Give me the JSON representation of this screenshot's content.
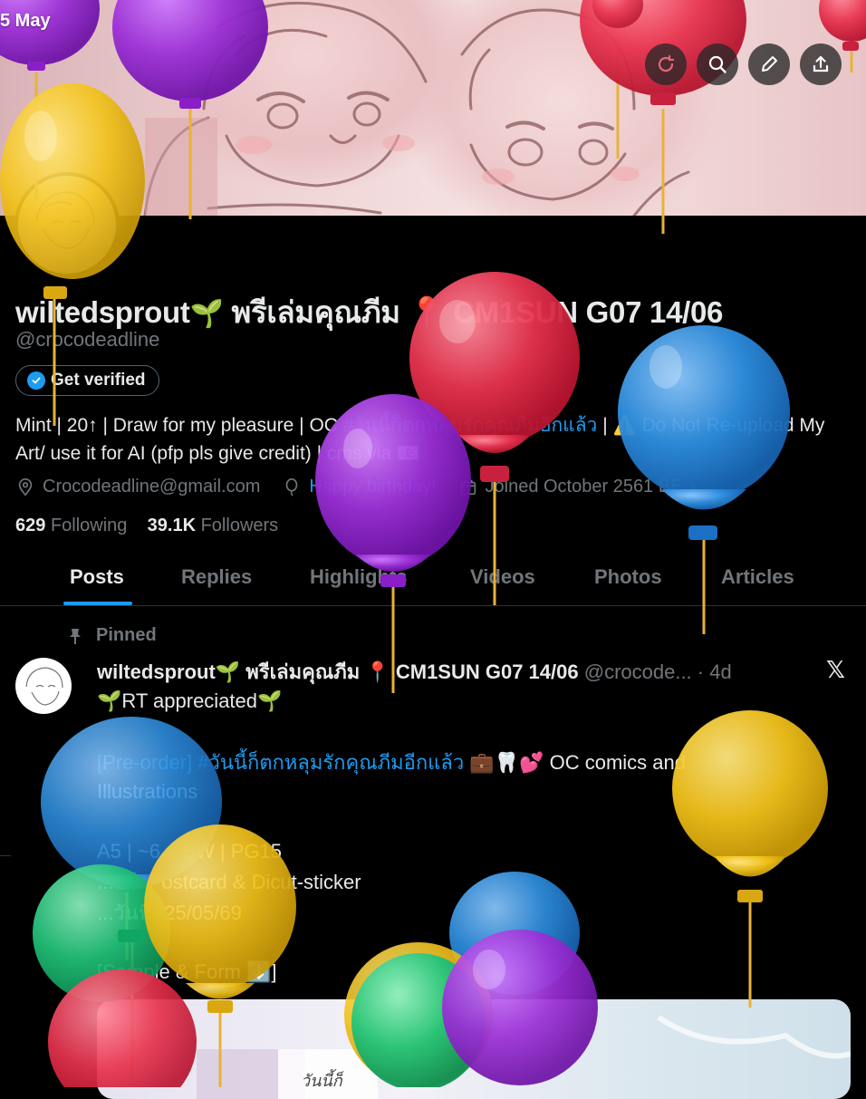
{
  "status_bar": {
    "time": "5 May"
  },
  "header_actions": [
    "refresh-icon",
    "search-icon",
    "edit-icon",
    "share-icon"
  ],
  "profile": {
    "display_name": "wiltedsprout🌱 พรีเล่มคุณภีม 📍 CM1SUN G07 14/06",
    "name_main": "wiltedsprout",
    "name_seed": "🌱",
    "name_rest": " พรีเล่มคุณภีม 📍 CM1SUN G07 14/06",
    "handle": "@crocodeadline",
    "verify_label": "Get verified",
    "bio": {
      "part1": "Mint | 20↑ | Draw for my pleasure | OC ",
      "hashtag": "#วันนี้ก็ตกหลุมรักคุณภีมอีกแล้ว",
      "part2": " | ⚠️ Do Not Re-upload My Art/ use it for AI (pfp pls give credit) | cms via 📧"
    },
    "email": "Crocodeadline@gmail.com",
    "birthday_link": "Happy birthday!",
    "joined": "Joined October 2561 BE",
    "following_count": "629",
    "following_label": "Following",
    "followers_count": "39.1K",
    "followers_label": "Followers"
  },
  "tabs": [
    "Posts",
    "Replies",
    "Highlights",
    "Videos",
    "Photos",
    "Articles"
  ],
  "active_tab": "Posts",
  "post": {
    "pinned_label": "Pinned",
    "author_name": "wiltedsprout🌱 พรีเล่มคุณภีม 📍 CM1SUN G07 14/06",
    "author_handle": "@crocode...",
    "time": "· 4d",
    "line1": "🌱RT appreciated🌱",
    "line2_link1": "[Pre-order]",
    "line2_link2": "#วันนี้ก็ตกหลุมรักคุณภีมอีกแล้ว",
    "line2_rest": " 💼🦷💕 OC comics and",
    "line3": "Illustrations",
    "line4": "A5 | ~6... BW | PG15",
    "line5": "...พรี: Postcard & Dicut-sticker",
    "line6": "...วันนี้- 25/05/69",
    "line7": "[Sample & Form ⬇️]",
    "media_title": "วันนี้ก็"
  },
  "colors": {
    "accent": "#1d9bf0",
    "background": "#000000",
    "text": "#e7e9ea",
    "muted": "#71767b",
    "balloon_red": "#e8334f",
    "balloon_purple": "#9b2fd6",
    "balloon_yellow": "#f2c21c",
    "balloon_blue": "#2e8fe0",
    "balloon_green": "#22c47a"
  }
}
